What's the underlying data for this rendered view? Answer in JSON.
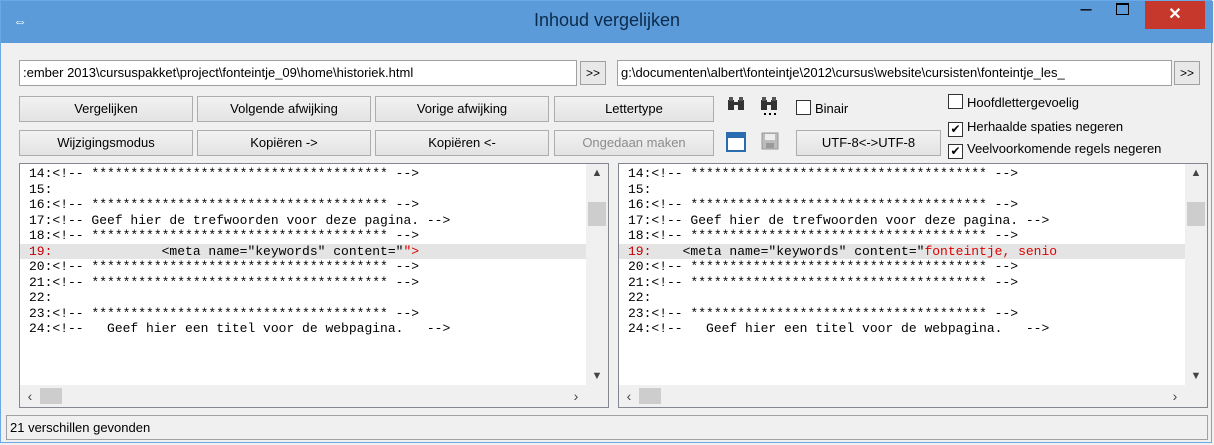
{
  "window": {
    "title": "Inhoud vergelijken",
    "close_glyph": "✕",
    "minimize_glyph": "–"
  },
  "paths": {
    "left": ":ember 2013\\cursuspakket\\project\\fonteintje_09\\home\\historiek.html",
    "right": "g:\\documenten\\albert\\fonteintje\\2012\\cursus\\website\\cursisten\\fonteintje_les_",
    "browse_label": ">>"
  },
  "toolbar": {
    "compare": "Vergelijken",
    "next_diff": "Volgende afwijking",
    "prev_diff": "Vorige afwijking",
    "font": "Lettertype",
    "edit_mode": "Wijzigingsmodus",
    "copy_right": "Kopiëren ->",
    "copy_left": "Kopiëren <-",
    "undo": "Ongedaan maken",
    "encoding": "UTF-8<->UTF-8",
    "binary": "Binair",
    "binary_checked": false
  },
  "options": {
    "case_sensitive": {
      "label": "Hoofdlettergevoelig",
      "checked": false
    },
    "ignore_spaces": {
      "label": "Herhaalde spaties negeren",
      "checked": true
    },
    "ignore_common": {
      "label": "Veelvoorkomende regels negeren",
      "checked": true
    }
  },
  "left_pane": {
    "lines": [
      {
        "num": "14:",
        "text": "<!-- ************************************** -->"
      },
      {
        "num": "15:",
        "text": ""
      },
      {
        "num": "16:",
        "text": "<!-- ************************************** -->"
      },
      {
        "num": "17:",
        "text": "<!-- Geef hier de trefwoorden voor deze pagina. -->"
      },
      {
        "num": "18:",
        "text": "<!-- ************************************** -->"
      },
      {
        "num": "19:",
        "text": "              <meta name=\"keywords\" content=\"",
        "red": "\">",
        "diff": true
      },
      {
        "num": "20:",
        "text": "<!-- ************************************** -->"
      },
      {
        "num": "21:",
        "text": "<!-- ************************************** -->"
      },
      {
        "num": "22:",
        "text": ""
      },
      {
        "num": "23:",
        "text": "<!-- ************************************** -->"
      },
      {
        "num": "24:",
        "text": "<!--   Geef hier een titel voor de webpagina.   -->"
      }
    ]
  },
  "right_pane": {
    "lines": [
      {
        "num": "14:",
        "text": "<!-- ************************************** -->"
      },
      {
        "num": "15:",
        "text": ""
      },
      {
        "num": "16:",
        "text": "<!-- ************************************** -->"
      },
      {
        "num": "17:",
        "text": "<!-- Geef hier de trefwoorden voor deze pagina. -->"
      },
      {
        "num": "18:",
        "text": "<!-- ************************************** -->"
      },
      {
        "num": "19:",
        "text": "    <meta name=\"keywords\" content=\"",
        "red": "fonteintje, senio",
        "diff": true
      },
      {
        "num": "20:",
        "text": "<!-- ************************************** -->"
      },
      {
        "num": "21:",
        "text": "<!-- ************************************** -->"
      },
      {
        "num": "22:",
        "text": ""
      },
      {
        "num": "23:",
        "text": "<!-- ************************************** -->"
      },
      {
        "num": "24:",
        "text": "<!--   Geef hier een titel voor de webpagina.   -->"
      }
    ]
  },
  "status": {
    "text": "21 verschillen gevonden"
  },
  "icons": {
    "app": "compare-icon",
    "find": "binoculars-icon",
    "find_next": "binoculars-more-icon",
    "window_mode": "window-icon",
    "save": "save-icon"
  }
}
